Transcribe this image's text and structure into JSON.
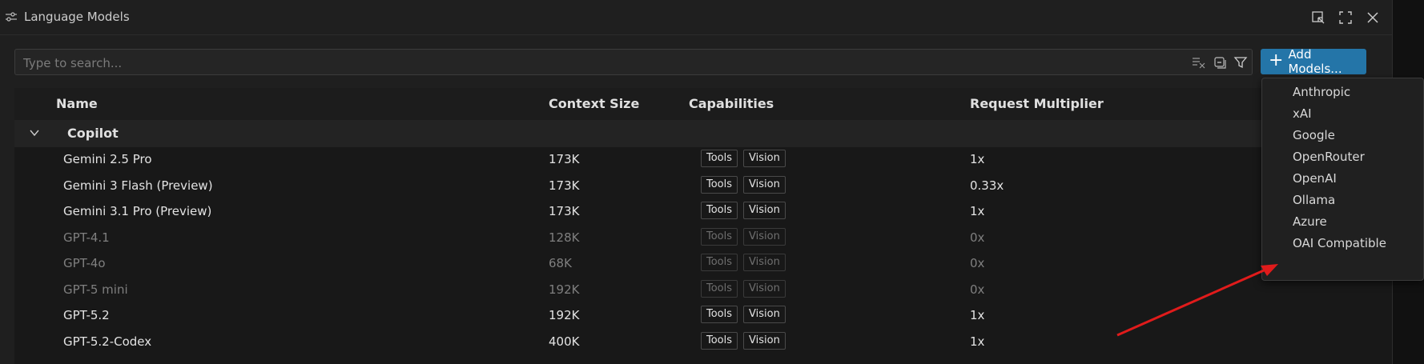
{
  "window": {
    "title": "Language Models"
  },
  "search": {
    "placeholder": "Type to search..."
  },
  "add_button": {
    "label": "Add Models..."
  },
  "table": {
    "columns": [
      "Name",
      "Context Size",
      "Capabilities",
      "Request Multiplier"
    ],
    "group": {
      "label": "Copilot"
    },
    "rows": [
      {
        "name": "Gemini 2.5 Pro",
        "context": "173K",
        "caps": [
          "Tools",
          "Vision"
        ],
        "multiplier": "1x",
        "enabled": true
      },
      {
        "name": "Gemini 3 Flash (Preview)",
        "context": "173K",
        "caps": [
          "Tools",
          "Vision"
        ],
        "multiplier": "0.33x",
        "enabled": true
      },
      {
        "name": "Gemini 3.1 Pro (Preview)",
        "context": "173K",
        "caps": [
          "Tools",
          "Vision"
        ],
        "multiplier": "1x",
        "enabled": true
      },
      {
        "name": "GPT-4.1",
        "context": "128K",
        "caps": [
          "Tools",
          "Vision"
        ],
        "multiplier": "0x",
        "enabled": false
      },
      {
        "name": "GPT-4o",
        "context": "68K",
        "caps": [
          "Tools",
          "Vision"
        ],
        "multiplier": "0x",
        "enabled": false
      },
      {
        "name": "GPT-5 mini",
        "context": "192K",
        "caps": [
          "Tools",
          "Vision"
        ],
        "multiplier": "0x",
        "enabled": false
      },
      {
        "name": "GPT-5.2",
        "context": "192K",
        "caps": [
          "Tools",
          "Vision"
        ],
        "multiplier": "1x",
        "enabled": true
      },
      {
        "name": "GPT-5.2-Codex",
        "context": "400K",
        "caps": [
          "Tools",
          "Vision"
        ],
        "multiplier": "1x",
        "enabled": true
      }
    ]
  },
  "dropdown": {
    "items": [
      "Anthropic",
      "xAI",
      "Google",
      "OpenRouter",
      "OpenAI",
      "Ollama",
      "Azure",
      "OAI Compatible"
    ]
  },
  "colors": {
    "accent": "#2475a8",
    "annotation_arrow": "#e01b1b"
  },
  "icons": {
    "title": "sliders-icon",
    "title_actions": [
      "open-in-editor-icon",
      "maximize-icon",
      "close-icon"
    ],
    "search_actions": [
      "clear-filter-icon",
      "collapse-all-icon",
      "filter-icon"
    ]
  }
}
